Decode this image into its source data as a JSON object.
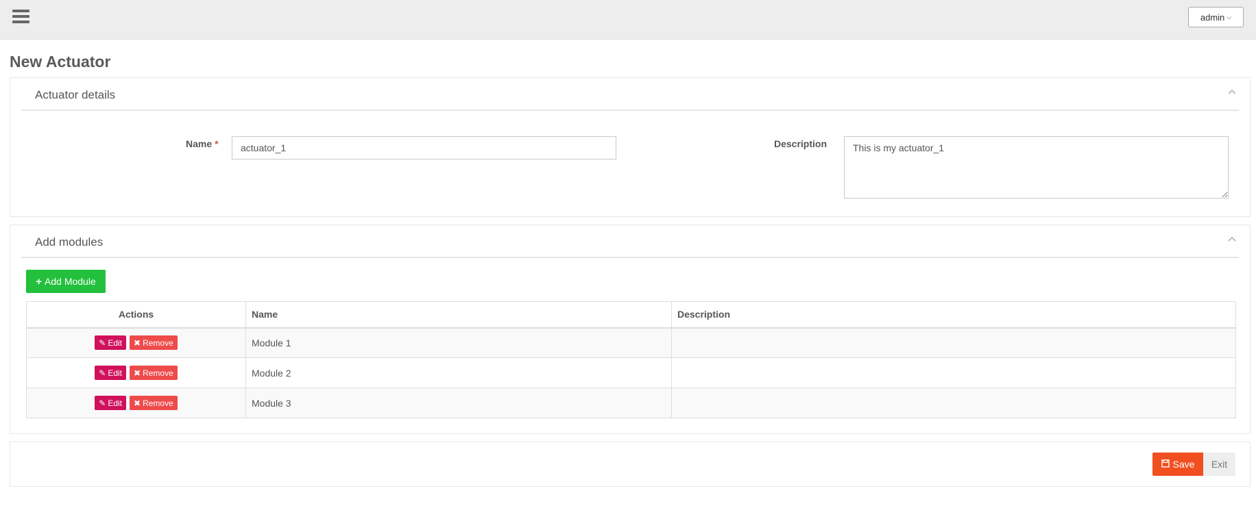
{
  "header": {
    "menu_icon": "hamburger-icon",
    "user_label": "admin",
    "user_caret_icon": "chevron-down-icon"
  },
  "page": {
    "title": "New Actuator"
  },
  "details_panel": {
    "title": "Actuator details",
    "collapse_icon": "chevron-up-icon",
    "name_label": "Name",
    "required_marker": "*",
    "name_value": "actuator_1",
    "description_label": "Description",
    "description_value": "This is my actuator_1"
  },
  "modules_panel": {
    "title": "Add modules",
    "collapse_icon": "chevron-up-icon",
    "add_button_label": "Add Module",
    "add_icon": "plus-icon",
    "columns": [
      "Actions",
      "Name",
      "Description"
    ],
    "edit_label": "Edit",
    "edit_icon": "edit-icon",
    "remove_label": "Remove",
    "remove_icon": "close-icon",
    "rows": [
      {
        "name": "Module 1",
        "description": ""
      },
      {
        "name": "Module 2",
        "description": ""
      },
      {
        "name": "Module 3",
        "description": ""
      }
    ]
  },
  "footer": {
    "save_label": "Save",
    "save_icon": "floppy-disk-icon",
    "exit_label": "Exit"
  },
  "colors": {
    "add_button": "#22c03c",
    "edit_button": "#d0115c",
    "remove_button": "#ee4b4b",
    "save_button": "#f14f1f",
    "required": "#d9534f"
  }
}
